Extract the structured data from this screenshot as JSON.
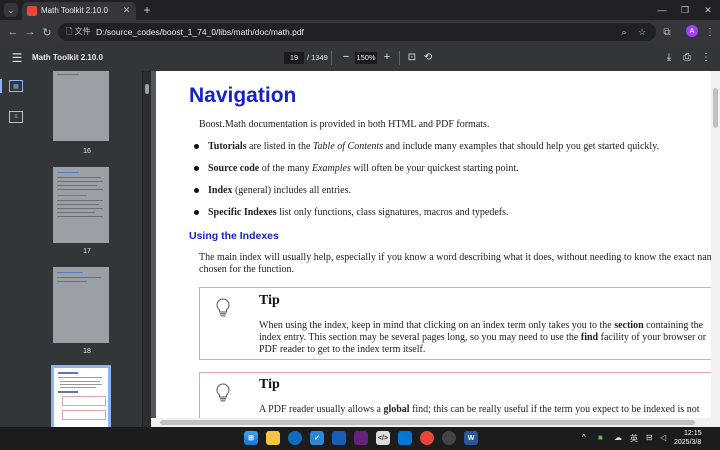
{
  "tab": {
    "title": "Math Toolkit 2.10.0",
    "favicon": "PDF"
  },
  "address": {
    "site_label": "文件",
    "url": "D:/source_codes/boost_1_74_0/libs/math/doc/math.pdf"
  },
  "pdf_toolbar": {
    "title": "Math Toolkit 2.10.0",
    "page": "19",
    "page_total": "/ 1349",
    "zoom": "150%"
  },
  "profile_initial": "A",
  "sidebar": {
    "thumbnails": [
      {
        "label": "16"
      },
      {
        "label": "17"
      },
      {
        "label": "18"
      }
    ]
  },
  "page": {
    "heading": "Navigation",
    "intro": "Boost.Math documentation is provided in both HTML and PDF formats.",
    "bullets": [
      {
        "bold": "Tutorials",
        "pre": " are listed in the ",
        "ital": "Table of Contents",
        "post": " and include many examples that should help you get started quickly."
      },
      {
        "bold": "Source code",
        "pre": " of the many ",
        "ital": "Examples",
        "post": " will often be your quickest starting point."
      },
      {
        "bold": "Index",
        "pre": " (general) includes all entries.",
        "ital": "",
        "post": ""
      },
      {
        "bold": "Specific Indexes",
        "pre": " list only functions, class signatures, macros and typedefs.",
        "ital": "",
        "post": ""
      }
    ],
    "subheading": "Using the Indexes",
    "main_index_line1": "The main index will usually help, especially if you know a word describing what it does, without needing to know the exact name",
    "main_index_line2": "chosen for the function.",
    "tip1": {
      "title": "Tip",
      "l1a": "When using the index, keep in mind that clicking on an index term only takes you to the ",
      "l1b": "section",
      "l1c": " containing the",
      "l2": "index entry. This section may be several pages long, so you may need to use the ",
      "l2b": "find",
      "l2c": " facility of your browser or",
      "l3": "PDF reader to get to the index term itself."
    },
    "tip2": {
      "title": "Tip",
      "l1a": "A PDF reader usually allows a ",
      "l1b": "global",
      "l1c": " find; this can be really useful if the term you expect to be indexed is not"
    }
  },
  "taskbar": {
    "ime": "英",
    "time": "12:15",
    "date": "2025/3/8"
  },
  "colors": {
    "accent": "#8ab4f8",
    "heading_blue": "#1523c8",
    "tip_border": "#e3a4a4"
  }
}
